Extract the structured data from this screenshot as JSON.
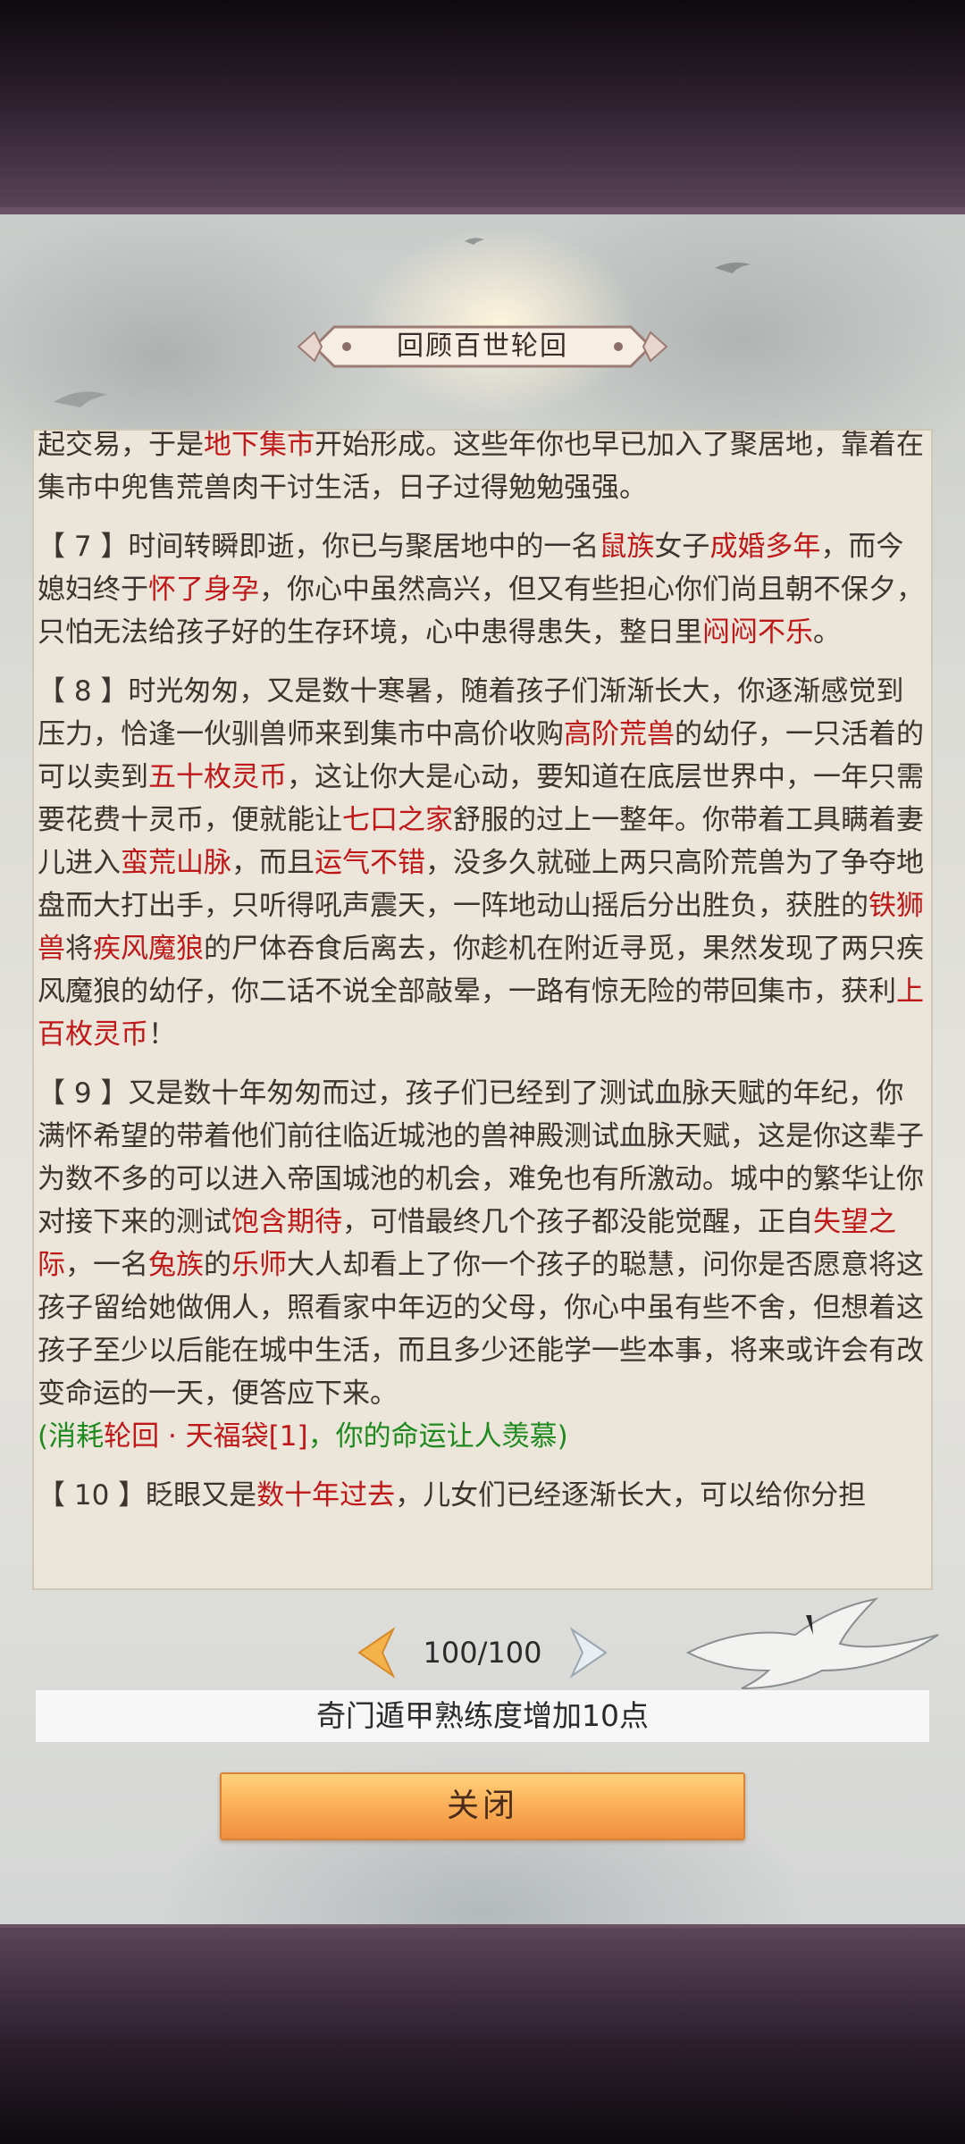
{
  "dialog": {
    "title": "回顾百世轮回"
  },
  "story": {
    "p0": [
      {
        "t": "起交易，于是"
      },
      {
        "t": "地下集市",
        "h": true
      },
      {
        "t": "开始形成。这些年你也早已加入了聚居地，靠着在集市中兜售荒兽肉干讨生活，日子过得勉勉强强。"
      }
    ],
    "p7": [
      {
        "t": "【 7 】时间转瞬即逝，你已与聚居地中的一名"
      },
      {
        "t": "鼠族",
        "h": true
      },
      {
        "t": "女子"
      },
      {
        "t": "成婚多年",
        "h": true
      },
      {
        "t": "，而今媳妇终于"
      },
      {
        "t": "怀了身孕",
        "h": true
      },
      {
        "t": "，你心中虽然高兴，但又有些担心你们尚且朝不保夕，只怕无法给孩子好的生存环境，心中患得患失，整日里"
      },
      {
        "t": "闷闷不乐",
        "h": true
      },
      {
        "t": "。"
      }
    ],
    "p8": [
      {
        "t": "【 8 】时光匆匆，又是数十寒暑，随着孩子们渐渐长大，你逐渐感觉到压力，恰逢一伙驯兽师来到集市中高价收购"
      },
      {
        "t": "高阶荒兽",
        "h": true
      },
      {
        "t": "的幼仔，一只活着的可以卖到"
      },
      {
        "t": "五十枚灵币",
        "h": true
      },
      {
        "t": "，这让你大是心动，要知道在底层世界中，一年只需要花费十灵币，便就能让"
      },
      {
        "t": "七口之家",
        "h": true
      },
      {
        "t": "舒服的过上一整年。你带着工具瞒着妻儿进入"
      },
      {
        "t": "蛮荒山脉",
        "h": true
      },
      {
        "t": "，而且"
      },
      {
        "t": "运气不错",
        "h": true
      },
      {
        "t": "，没多久就碰上两只高阶荒兽为了争夺地盘而大打出手，只听得吼声震天，一阵地动山摇后分出胜负，获胜的"
      },
      {
        "t": "铁狮兽",
        "h": true
      },
      {
        "t": "将"
      },
      {
        "t": "疾风魔狼",
        "h": true
      },
      {
        "t": "的尸体吞食后离去，你趁机在附近寻觅，果然发现了两只疾风魔狼的幼仔，你二话不说全部敲晕，一路有惊无险的带回集市，获利"
      },
      {
        "t": "上百枚灵币",
        "h": true
      },
      {
        "t": "！"
      }
    ],
    "p9": [
      {
        "t": "【 9 】又是数十年匆匆而过，孩子们已经到了测试血脉天赋的年纪，你满怀希望的带着他们前往临近城池的兽神殿测试血脉天赋，这是你这辈子为数不多的可以进入帝国城池的机会，难免也有所激动。城中的繁华让你对接下来的测试"
      },
      {
        "t": "饱含期待",
        "h": true
      },
      {
        "t": "，可惜最终几个孩子都没能觉醒，正自"
      },
      {
        "t": "失望之际",
        "h": true
      },
      {
        "t": "，一名"
      },
      {
        "t": "兔族",
        "h": true
      },
      {
        "t": "的"
      },
      {
        "t": "乐师",
        "h": true
      },
      {
        "t": "大人却看上了你一个孩子的聪慧，问你是否愿意将这孩子留给她做佣人，照看家中年迈的父母，你心中虽有些不舍，但想着这孩子至少以后能在城中生活，而且多少还能学一些本事，将来或许会有改变命运的一天，便答应下来。"
      }
    ],
    "p9_note": [
      {
        "t": "(消耗"
      },
      {
        "t": "轮回 · 天福袋[1]",
        "h": true
      },
      {
        "t": "，你的命运让人羡慕)"
      }
    ],
    "p10": [
      {
        "t": "【 10 】眨眼又是"
      },
      {
        "t": "数十年过去",
        "h": true
      },
      {
        "t": "，儿女们已经逐渐长大，可以给你分担"
      }
    ]
  },
  "pager": {
    "indicator": "100/100"
  },
  "reward": {
    "text": "奇门遁甲熟练度增加10点"
  },
  "buttons": {
    "close_label": "关闭"
  },
  "colors": {
    "highlight": "#c01818",
    "note": "#1e8a1e",
    "button": "#f6a34c"
  },
  "icons": {
    "prev": "chevron-left-icon",
    "next": "chevron-right-icon"
  }
}
